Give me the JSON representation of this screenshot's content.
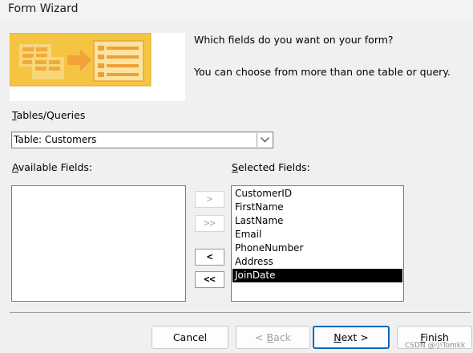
{
  "window": {
    "title": "Form Wizard"
  },
  "intro": {
    "line1": "Which fields do you want on your form?",
    "line2": "You can choose from more than one table or query."
  },
  "tables_queries": {
    "label_accel": "T",
    "label_rest": "ables/Queries",
    "selected": "Table: Customers"
  },
  "available_fields": {
    "label_accel": "A",
    "label_rest": "vailable Fields:",
    "items": []
  },
  "selected_fields": {
    "label_accel": "S",
    "label_rest": "elected Fields:",
    "items": [
      "CustomerID",
      "FirstName",
      "LastName",
      "Email",
      "PhoneNumber",
      "Address",
      "JoinDate"
    ],
    "selected_item": "JoinDate"
  },
  "move_buttons": {
    "add_one": ">",
    "add_all": ">>",
    "remove_one": "<",
    "remove_all": "<<"
  },
  "buttons": {
    "cancel": "Cancel",
    "back_prefix": "< ",
    "back_accel": "B",
    "back_rest": "ack",
    "next_accel": "N",
    "next_rest": "ext >",
    "finish_accel": "F",
    "finish_rest": "inish"
  },
  "watermark": "CSDN @小Tomkk",
  "colors": {
    "accent": "#0067c0",
    "selection": "#000000",
    "illustration": "#f5c242"
  }
}
